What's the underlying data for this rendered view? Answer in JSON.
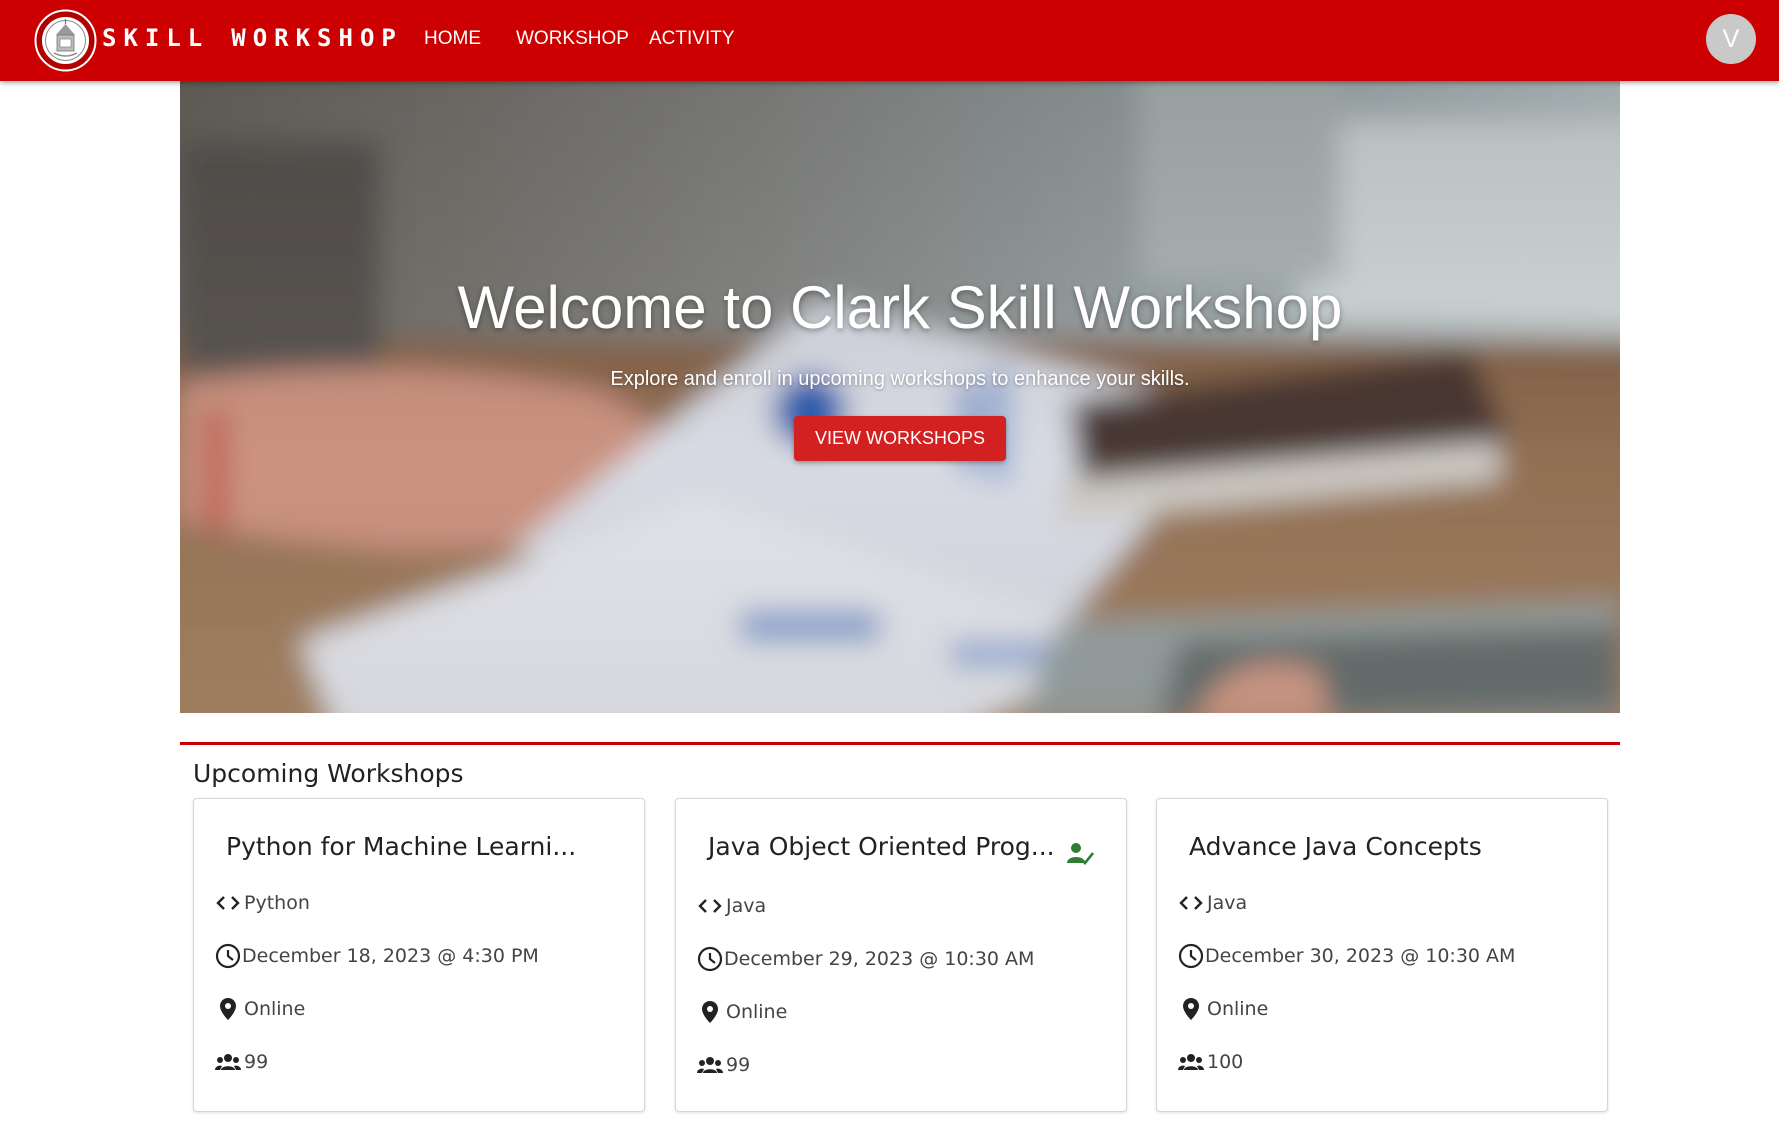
{
  "header": {
    "brand_word1": "SKILL",
    "brand_word2": "WORKSHOP",
    "nav": [
      {
        "label": "HOME"
      },
      {
        "label": "WORKSHOP"
      },
      {
        "label": "ACTIVITY"
      }
    ],
    "avatar_initial": "V",
    "logo_icon": "clark-university-seal-icon",
    "bar_color": "#cc0000"
  },
  "hero": {
    "title": "Welcome to Clark Skill Workshop",
    "subtitle": "Explore and enroll in upcoming workshops to enhance your skills.",
    "button_label": "VIEW WORKSHOPS",
    "button_color": "#d32020"
  },
  "section": {
    "title": "Upcoming Workshops"
  },
  "workshops": [
    {
      "title": "Python for Machine Learni...",
      "language": "Python",
      "datetime": "December 18, 2023 @ 4:30 PM",
      "location": "Online",
      "seats": "99",
      "enrolled": false
    },
    {
      "title": "Java Object Oriented Prog...",
      "language": "Java",
      "datetime": "December 29, 2023 @ 10:30 AM",
      "location": "Online",
      "seats": "99",
      "enrolled": true,
      "enrolled_icon": "person-check-icon",
      "enrolled_color": "#2e7d32"
    },
    {
      "title": "Advance Java Concepts",
      "language": "Java",
      "datetime": "December 30, 2023 @ 10:30 AM",
      "location": "Online",
      "seats": "100",
      "enrolled": false
    }
  ],
  "icons": {
    "language": "code-brackets-icon",
    "datetime": "clock-icon",
    "location": "location-pin-icon",
    "seats": "people-group-icon"
  }
}
